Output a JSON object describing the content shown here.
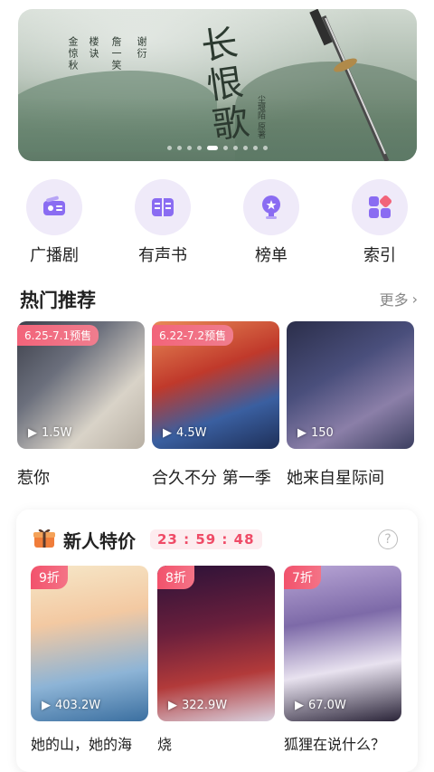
{
  "banner": {
    "title": "长恨歌",
    "credits": [
      "金惊秋",
      "楼诀",
      "詹一笑",
      "谢衍"
    ],
    "side_credit": "尘堰陌 原著",
    "page_count": 10,
    "active_index": 4
  },
  "quick_nav": [
    {
      "label": "广播剧",
      "icon": "radio-icon"
    },
    {
      "label": "有声书",
      "icon": "book-icon"
    },
    {
      "label": "榜单",
      "icon": "trophy-icon"
    },
    {
      "label": "索引",
      "icon": "index-grid-icon"
    }
  ],
  "hot": {
    "title": "热门推荐",
    "more": "更多",
    "items": [
      {
        "title": "惹你",
        "plays": "1.5W",
        "presale": "6.25-7.1预售"
      },
      {
        "title": "合久不分 第一季",
        "plays": "4.5W",
        "presale": "6.22-7.2预售"
      },
      {
        "title": "她来自星际间",
        "plays": "150",
        "presale": ""
      }
    ]
  },
  "deal": {
    "title": "新人特价",
    "countdown": {
      "h": "23",
      "m": "59",
      "s": "48"
    },
    "help": "?",
    "items": [
      {
        "title": "她的山，她的海",
        "plays": "403.2W",
        "discount": "9折"
      },
      {
        "title": "烧",
        "plays": "322.9W",
        "discount": "8折"
      },
      {
        "title": "狐狸在说什么？",
        "plays": "67.0W",
        "discount": "7折"
      }
    ]
  },
  "colors": {
    "accent": "#8a6cf2",
    "icon_bg": "#efeaf9",
    "sale": "#ef4b67"
  }
}
